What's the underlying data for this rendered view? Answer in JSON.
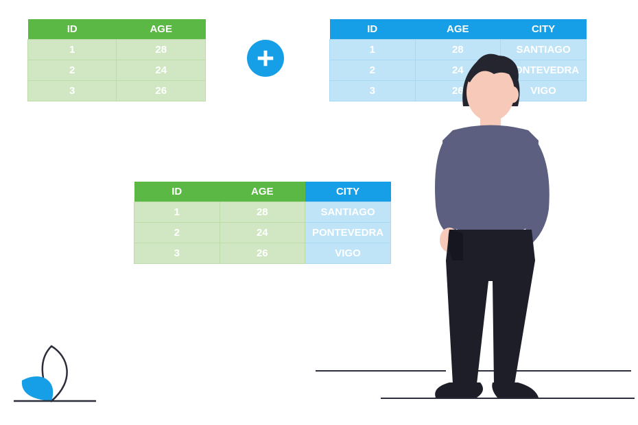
{
  "colors": {
    "green_header": "#5cb844",
    "green_cell": "#d1e7c4",
    "blue_header": "#169fe6",
    "blue_cell": "#bfe3f7",
    "dark": "#2b2d3a"
  },
  "tables": {
    "left": {
      "headers": [
        "ID",
        "AGE"
      ],
      "rows": [
        [
          "1",
          "28"
        ],
        [
          "2",
          "24"
        ],
        [
          "3",
          "26"
        ]
      ]
    },
    "right": {
      "headers": [
        "ID",
        "AGE",
        "CITY"
      ],
      "rows": [
        [
          "1",
          "28",
          "SANTIAGO"
        ],
        [
          "2",
          "24",
          "PONTEVEDRA"
        ],
        [
          "3",
          "26",
          "VIGO"
        ]
      ]
    },
    "result": {
      "headers": [
        "ID",
        "AGE",
        "CITY"
      ],
      "rows": [
        [
          "1",
          "28",
          "SANTIAGO"
        ],
        [
          "2",
          "24",
          "PONTEVEDRA"
        ],
        [
          "3",
          "26",
          "VIGO"
        ]
      ]
    }
  },
  "operator": "plus"
}
